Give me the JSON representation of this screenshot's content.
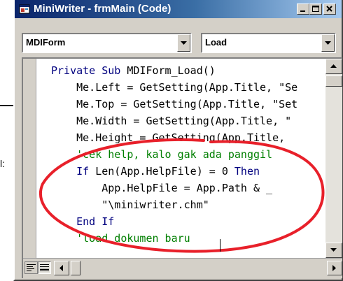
{
  "background_fragment": {
    "text": "l:"
  },
  "window": {
    "title": "MiniWriter - frmMain (Code)",
    "controls": {
      "minimize": "minimize-icon",
      "maximize": "maximize-icon",
      "close": "close-icon"
    }
  },
  "object_combo": {
    "value": "MDIForm"
  },
  "procedure_combo": {
    "value": "Load"
  },
  "code_lines": [
    {
      "segments": [
        {
          "type": "keyword",
          "text": "Private Sub "
        },
        {
          "type": "text",
          "text": "MDIForm_Load()"
        }
      ]
    },
    {
      "segments": [
        {
          "type": "text",
          "text": "    Me.Left = GetSetting(App.Title, \"Se"
        }
      ]
    },
    {
      "segments": [
        {
          "type": "text",
          "text": "    Me.Top = GetSetting(App.Title, \"Set"
        }
      ]
    },
    {
      "segments": [
        {
          "type": "text",
          "text": "    Me.Width = GetSetting(App.Title, \""
        }
      ]
    },
    {
      "segments": [
        {
          "type": "text",
          "text": "    Me.Height = GetSetting(App.Title,"
        }
      ]
    },
    {
      "segments": [
        {
          "type": "comment",
          "text": "    'cek help, kalo gak ada panggil"
        }
      ]
    },
    {
      "segments": [
        {
          "type": "keyword",
          "text": "    If "
        },
        {
          "type": "text",
          "text": "Len(App.HelpFile) = 0 "
        },
        {
          "type": "keyword",
          "text": "Then"
        }
      ]
    },
    {
      "segments": [
        {
          "type": "text",
          "text": "        App.HelpFile = App.Path & _"
        }
      ]
    },
    {
      "segments": [
        {
          "type": "text",
          "text": "        \"\\miniwriter.chm\""
        }
      ]
    },
    {
      "segments": [
        {
          "type": "keyword",
          "text": "    End If"
        }
      ]
    },
    {
      "segments": [
        {
          "type": "comment",
          "text": "    'load dokumen baru"
        }
      ]
    }
  ],
  "colors": {
    "keyword": "#00007f",
    "text": "#000000",
    "comment": "#007f00",
    "annotation": "#e8202a"
  }
}
